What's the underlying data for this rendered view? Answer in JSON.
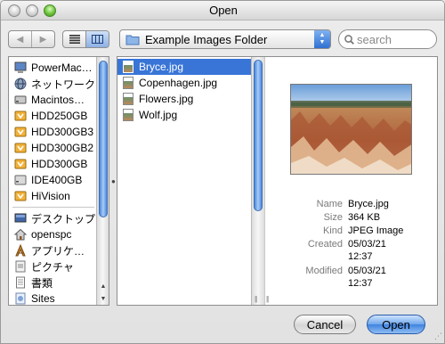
{
  "window": {
    "title": "Open"
  },
  "toolbar": {
    "location": "Example Images Folder",
    "search_placeholder": "search"
  },
  "sidebar": {
    "devices": [
      {
        "label": "PowerMac…",
        "icon": "computer-icon"
      },
      {
        "label": "ネットワーク",
        "icon": "network-icon"
      },
      {
        "label": "Macintos…",
        "icon": "hard-drive-icon"
      },
      {
        "label": "HDD250GB",
        "icon": "drive-icon"
      },
      {
        "label": "HDD300GB3",
        "icon": "drive-icon"
      },
      {
        "label": "HDD300GB2",
        "icon": "drive-icon"
      },
      {
        "label": "HDD300GB",
        "icon": "drive-icon"
      },
      {
        "label": "IDE400GB",
        "icon": "drive-icon"
      },
      {
        "label": "HiVision",
        "icon": "drive-icon"
      }
    ],
    "places": [
      {
        "label": "デスクトップ",
        "icon": "desktop-icon"
      },
      {
        "label": "openspc",
        "icon": "home-icon"
      },
      {
        "label": "アプリケ…",
        "icon": "applications-icon"
      },
      {
        "label": "ピクチャ",
        "icon": "pictures-icon"
      },
      {
        "label": "書類",
        "icon": "documents-icon"
      },
      {
        "label": "Sites",
        "icon": "sites-icon"
      }
    ]
  },
  "files": [
    {
      "name": "Bryce.jpg",
      "selected": true
    },
    {
      "name": "Copenhagen.jpg",
      "selected": false
    },
    {
      "name": "Flowers.jpg",
      "selected": false
    },
    {
      "name": "Wolf.jpg",
      "selected": false
    }
  ],
  "preview": {
    "rows": [
      {
        "key": "Name",
        "value": "Bryce.jpg"
      },
      {
        "key": "Size",
        "value": "364 KB"
      },
      {
        "key": "Kind",
        "value": "JPEG Image"
      },
      {
        "key": "Created",
        "value": "05/03/21",
        "value2": "12:37"
      },
      {
        "key": "Modified",
        "value": "05/03/21",
        "value2": "12:37"
      }
    ]
  },
  "buttons": {
    "cancel": "Cancel",
    "open": "Open"
  },
  "colors": {
    "selection": "#3875d7",
    "accent": "#3f83df"
  }
}
